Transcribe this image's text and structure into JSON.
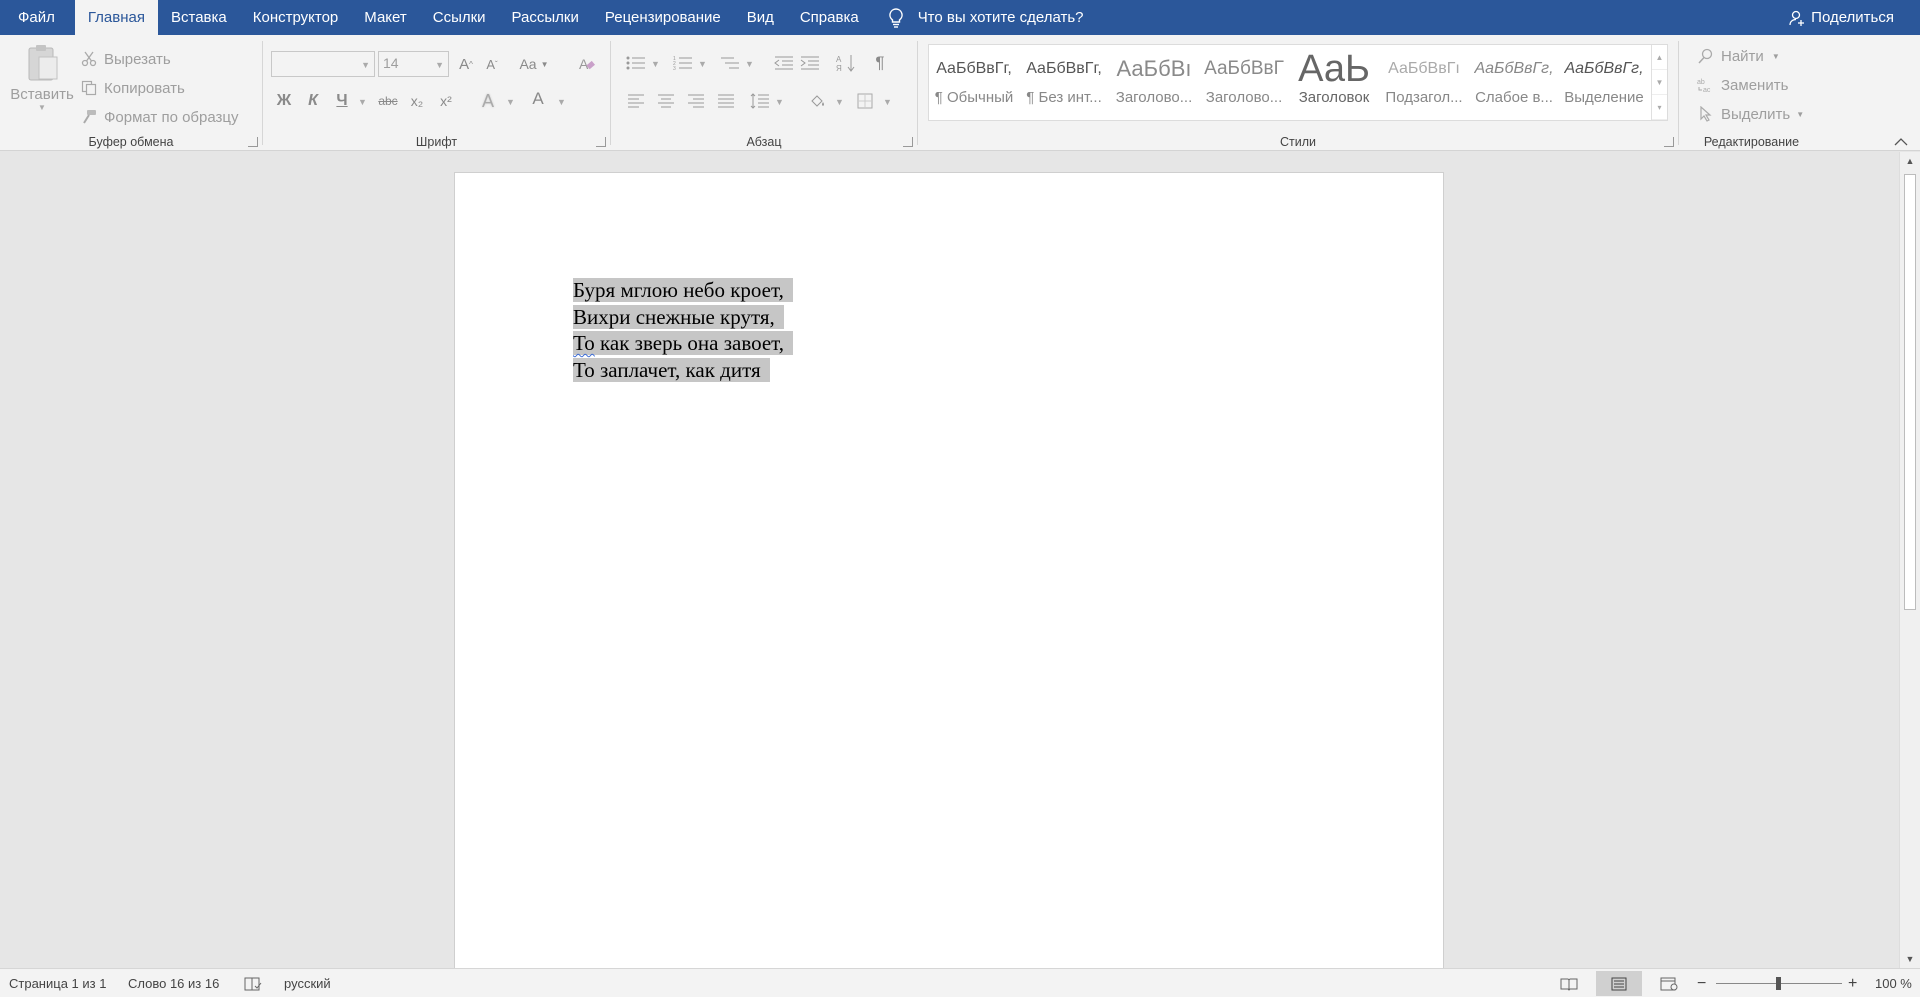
{
  "tabs": [
    {
      "label": "Файл"
    },
    {
      "label": "Главная"
    },
    {
      "label": "Вставка"
    },
    {
      "label": "Конструктор"
    },
    {
      "label": "Макет"
    },
    {
      "label": "Ссылки"
    },
    {
      "label": "Рассылки"
    },
    {
      "label": "Рецензирование"
    },
    {
      "label": "Вид"
    },
    {
      "label": "Справка"
    }
  ],
  "tell_me": "Что вы хотите сделать?",
  "share": "Поделиться",
  "clipboard": {
    "paste": "Вставить",
    "cut": "Вырезать",
    "copy": "Копировать",
    "format_painter": "Формат по образцу",
    "label": "Буфер обмена"
  },
  "font": {
    "family": "",
    "size": "14",
    "grow": "A",
    "shrink": "A",
    "change_case": "Aa",
    "bold": "Ж",
    "italic": "К",
    "underline": "Ч",
    "strike": "abc",
    "subscript": "x₂",
    "superscript": "x²",
    "effects": "A",
    "color": "A",
    "label": "Шрифт"
  },
  "paragraph": {
    "show_marks": "¶",
    "label": "Абзац"
  },
  "styles": {
    "items": [
      {
        "preview": "АаБбВвГг,",
        "name": "¶ Обычный"
      },
      {
        "preview": "АаБбВвГг,",
        "name": "¶ Без инт..."
      },
      {
        "preview": "АаБбВı",
        "name": "Заголово..."
      },
      {
        "preview": "АаБбВвГ",
        "name": "Заголово..."
      },
      {
        "preview": "АаЬ",
        "name": "Заголовок"
      },
      {
        "preview": "АаБбВвГı",
        "name": "Подзагол..."
      },
      {
        "preview": "АаБбВвГг,",
        "name": "Слабое в..."
      },
      {
        "preview": "АаБбВвГг,",
        "name": "Выделение"
      }
    ],
    "label": "Стили"
  },
  "editing": {
    "find": "Найти",
    "replace": "Заменить",
    "select": "Выделить",
    "label": "Редактирование"
  },
  "document": {
    "lines": [
      "Буря мглою небо кроет,",
      "Вихри снежные крутя,",
      "То как зверь она завоет,",
      "То заплачет, как дитя"
    ]
  },
  "status": {
    "page": "Страница 1 из 1",
    "words": "Слово 16 из 16",
    "language": "русский",
    "zoom": "100 %",
    "zoom_percent": 100
  },
  "colors": {
    "accent": "#2b579a",
    "selection": "#c6c6c6"
  }
}
